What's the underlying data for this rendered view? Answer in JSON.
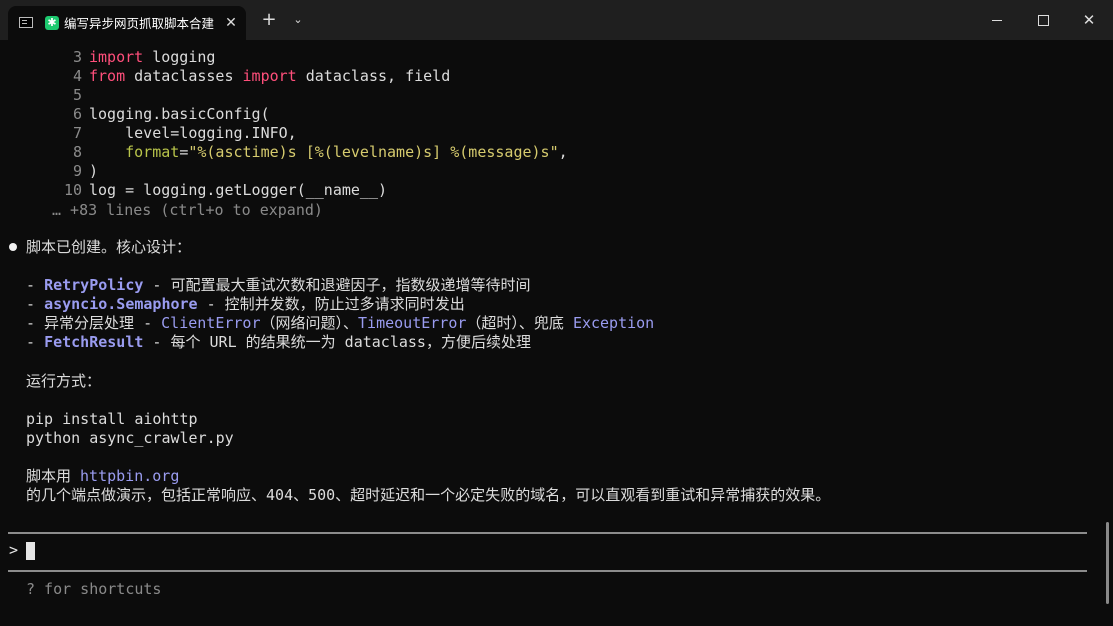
{
  "window": {
    "tab_title": "编写异步网页抓取脚本合建",
    "app_icon_glyph": "✱",
    "close_tab_glyph": "✕",
    "new_tab_glyph": "+",
    "dropdown_glyph": "⌄",
    "close_glyph": "✕"
  },
  "code_lines": [
    {
      "n": "3",
      "parts": [
        [
          "kw",
          "import"
        ],
        [
          "txt",
          " logging"
        ]
      ]
    },
    {
      "n": "4",
      "parts": [
        [
          "kw",
          "from"
        ],
        [
          "txt",
          " dataclasses "
        ],
        [
          "kw",
          "import"
        ],
        [
          "txt",
          " dataclass, field"
        ]
      ]
    },
    {
      "n": "5",
      "parts": []
    },
    {
      "n": "6",
      "parts": [
        [
          "txt",
          "logging.basicConfig("
        ]
      ]
    },
    {
      "n": "7",
      "parts": [
        [
          "txt",
          "    level=logging.INFO,"
        ]
      ]
    },
    {
      "n": "8",
      "parts": [
        [
          "txt",
          "    "
        ],
        [
          "kwarg",
          "format"
        ],
        [
          "txt",
          "="
        ],
        [
          "str",
          "\"%(asctime)s [%(levelname)s] %(message)s\""
        ],
        [
          "txt",
          ","
        ]
      ]
    },
    {
      "n": "9",
      "parts": [
        [
          "txt",
          ")"
        ]
      ]
    },
    {
      "n": "10",
      "parts": [
        [
          "txt",
          "log = logging.getLogger(__name__)"
        ]
      ]
    }
  ],
  "collapsed_note": "… +83 lines (ctrl+o to expand)",
  "summary_heading": "脚本已创建。核心设计：",
  "design_items": [
    [
      [
        "txt",
        "- "
      ],
      [
        "hl",
        "RetryPolicy"
      ],
      [
        "txt",
        " - 可配置最大重试次数和退避因子，指数级递增等待时间"
      ]
    ],
    [
      [
        "txt",
        "- "
      ],
      [
        "hl",
        "asyncio.Semaphore"
      ],
      [
        "txt",
        " - 控制并发数，防止过多请求同时发出"
      ]
    ],
    [
      [
        "txt",
        "- 异常分层处理 - "
      ],
      [
        "hl2",
        "ClientError"
      ],
      [
        "txt",
        "（网络问题）、"
      ],
      [
        "hl2",
        "TimeoutError"
      ],
      [
        "txt",
        "（超时）、兜底 "
      ],
      [
        "hl2",
        "Exception"
      ]
    ],
    [
      [
        "txt",
        "- "
      ],
      [
        "hl",
        "FetchResult"
      ],
      [
        "txt",
        " - 每个 URL 的结果统一为 dataclass，方便后续处理"
      ]
    ]
  ],
  "run_heading": "运行方式：",
  "run_commands": [
    "pip install aiohttp",
    "python async_crawler.py"
  ],
  "note_line1": [
    [
      "txt",
      "脚本用 "
    ],
    [
      "hl2",
      "httpbin.org"
    ]
  ],
  "note_line2": "的几个端点做演示，包括正常响应、404、500、超时延迟和一个必定失败的域名，可以直观看到重试和异常捕获的效果。",
  "prompt_caret": ">",
  "shortcuts_hint": "? for shortcuts",
  "colors": {
    "background": "#0c0c0c",
    "keyword": "#ff4f7b",
    "keyword_arg": "#b8c44a",
    "string": "#d6cb6e",
    "highlight": "#9a9cf0"
  }
}
